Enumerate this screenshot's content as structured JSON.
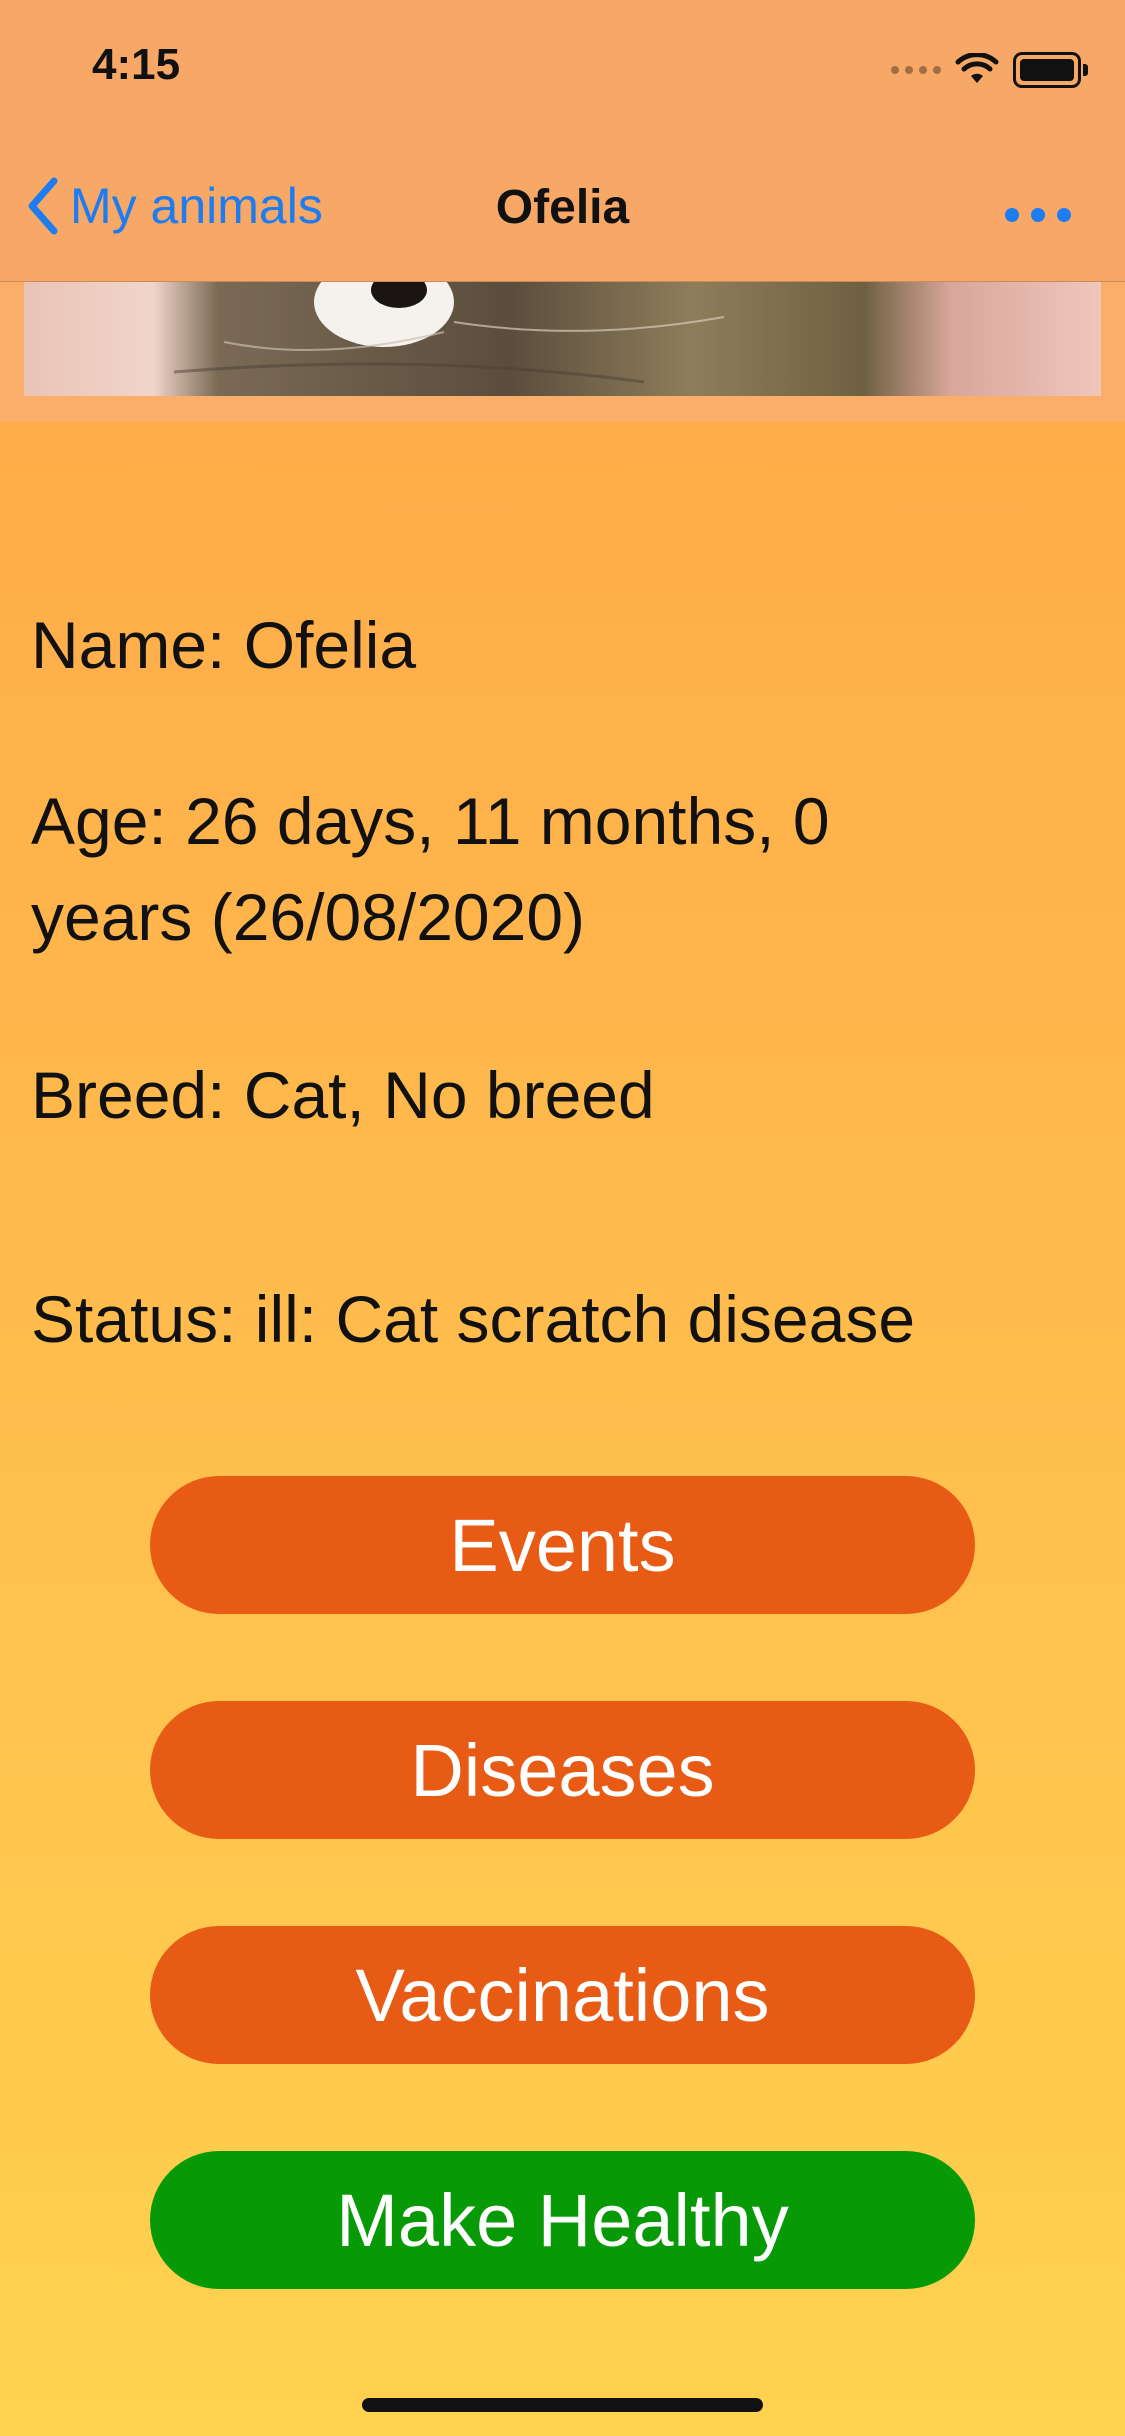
{
  "status_bar": {
    "time": "4:15"
  },
  "nav": {
    "back_label": "My animals",
    "title": "Ofelia"
  },
  "pet_info": {
    "name": "Name: Ofelia",
    "age_line1": "Age: 26 days, 11 months, 0",
    "age_line2": "years (26/08/2020)",
    "breed": "Breed: Cat, No breed",
    "status": "Status: ill: Cat scratch disease"
  },
  "buttons": {
    "events": "Events",
    "diseases": "Diseases",
    "vaccinations": "Vaccinations",
    "make_healthy": "Make Healthy"
  },
  "colors": {
    "accent_blue": "#1C7CF0",
    "button_orange": "#E85B15",
    "button_green": "#079A06",
    "header_bg": "#F7A867"
  },
  "icons": {
    "back": "chevron-left-icon",
    "more": "ellipsis-icon",
    "wifi": "wifi-icon",
    "battery": "battery-icon",
    "signal": "signal-icon"
  }
}
